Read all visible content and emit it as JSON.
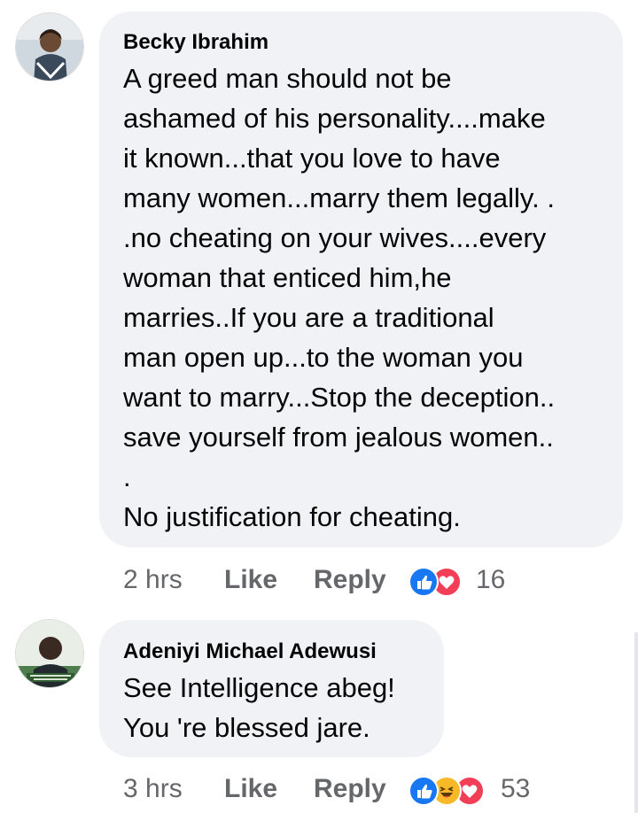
{
  "comments": [
    {
      "author": "Becky Ibrahim",
      "text_lines": [
        "A greed man should not be",
        "ashamed of his personality....make",
        "it known...that you love to have",
        "many women...marry them legally. .",
        ".no cheating on your wives....every",
        "woman that enticed him,he",
        "marries..If you are a traditional",
        "man open up...to the woman you",
        "want to marry...Stop the deception..",
        "save yourself from jealous women..",
        ".",
        "No justification for cheating."
      ],
      "time": "2 hrs",
      "like_label": "Like",
      "reply_label": "Reply",
      "reactions": [
        "like-icon",
        "love-icon"
      ],
      "reaction_count": "16"
    },
    {
      "author": "Adeniyi Michael Adewusi",
      "text_lines": [
        "See Intelligence abeg!",
        "You 're blessed jare."
      ],
      "time": "3 hrs",
      "like_label": "Like",
      "reply_label": "Reply",
      "reactions": [
        "like-icon",
        "haha-icon",
        "love-icon"
      ],
      "reaction_count": "53"
    }
  ],
  "colors": {
    "bubble": "#f0f2f5",
    "meta_text": "#65676b",
    "like_blue": "#1877f2",
    "love_red": "#f33e58",
    "haha_yellow": "#f7b928"
  }
}
